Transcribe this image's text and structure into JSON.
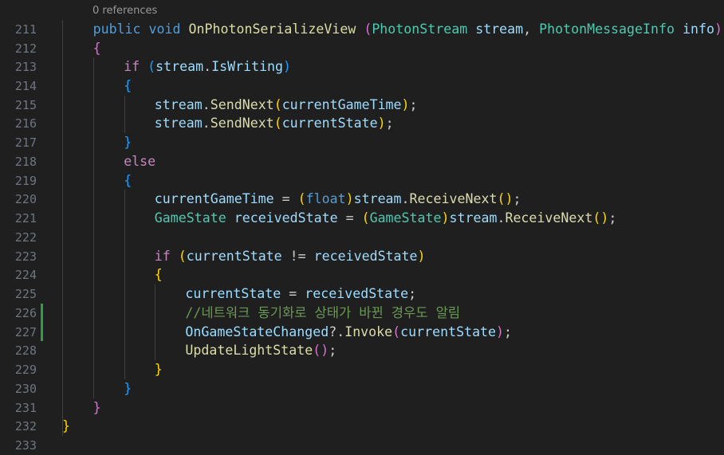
{
  "codelens": "0 references",
  "lines": [
    {
      "num": "211",
      "indent": 1,
      "tokens": [
        [
          "public",
          "kw"
        ],
        [
          " ",
          ""
        ],
        [
          "void",
          "kw"
        ],
        [
          " ",
          ""
        ],
        [
          "OnPhotonSerializeView",
          "fn"
        ],
        [
          " ",
          ""
        ],
        [
          "(",
          "b2"
        ],
        [
          "PhotonStream",
          "type"
        ],
        [
          " ",
          ""
        ],
        [
          "stream",
          "var"
        ],
        [
          ", ",
          ""
        ],
        [
          "PhotonMessageInfo",
          "type"
        ],
        [
          " ",
          ""
        ],
        [
          "info",
          "var"
        ],
        [
          ")",
          "b2"
        ]
      ]
    },
    {
      "num": "212",
      "indent": 1,
      "tokens": [
        [
          "{",
          "b2"
        ]
      ]
    },
    {
      "num": "213",
      "indent": 2,
      "tokens": [
        [
          "if",
          "ctrl"
        ],
        [
          " ",
          ""
        ],
        [
          "(",
          "b3"
        ],
        [
          "stream",
          "var"
        ],
        [
          ".",
          ""
        ],
        [
          "IsWriting",
          "var"
        ],
        [
          ")",
          "b3"
        ]
      ]
    },
    {
      "num": "214",
      "indent": 2,
      "tokens": [
        [
          "{",
          "b3"
        ]
      ]
    },
    {
      "num": "215",
      "indent": 3,
      "tokens": [
        [
          "stream",
          "var"
        ],
        [
          ".",
          ""
        ],
        [
          "SendNext",
          "fn"
        ],
        [
          "(",
          "b1"
        ],
        [
          "currentGameTime",
          "var"
        ],
        [
          ")",
          "b1"
        ],
        [
          ";",
          ""
        ]
      ]
    },
    {
      "num": "216",
      "indent": 3,
      "tokens": [
        [
          "stream",
          "var"
        ],
        [
          ".",
          ""
        ],
        [
          "SendNext",
          "fn"
        ],
        [
          "(",
          "b1"
        ],
        [
          "currentState",
          "var"
        ],
        [
          ")",
          "b1"
        ],
        [
          ";",
          ""
        ]
      ]
    },
    {
      "num": "217",
      "indent": 2,
      "tokens": [
        [
          "}",
          "b3"
        ]
      ]
    },
    {
      "num": "218",
      "indent": 2,
      "tokens": [
        [
          "else",
          "ctrl"
        ]
      ]
    },
    {
      "num": "219",
      "indent": 2,
      "tokens": [
        [
          "{",
          "b3"
        ]
      ]
    },
    {
      "num": "220",
      "indent": 3,
      "tokens": [
        [
          "currentGameTime",
          "var"
        ],
        [
          " = ",
          ""
        ],
        [
          "(",
          "b1"
        ],
        [
          "float",
          "kw"
        ],
        [
          ")",
          "b1"
        ],
        [
          "stream",
          "var"
        ],
        [
          ".",
          ""
        ],
        [
          "ReceiveNext",
          "fn"
        ],
        [
          "()",
          "b1"
        ],
        [
          ";",
          ""
        ]
      ]
    },
    {
      "num": "221",
      "indent": 3,
      "tokens": [
        [
          "GameState",
          "type"
        ],
        [
          " ",
          ""
        ],
        [
          "receivedState",
          "var"
        ],
        [
          " = ",
          ""
        ],
        [
          "(",
          "b1"
        ],
        [
          "GameState",
          "type"
        ],
        [
          ")",
          "b1"
        ],
        [
          "stream",
          "var"
        ],
        [
          ".",
          ""
        ],
        [
          "ReceiveNext",
          "fn"
        ],
        [
          "()",
          "b1"
        ],
        [
          ";",
          ""
        ]
      ]
    },
    {
      "num": "222",
      "indent": 0,
      "tokens": []
    },
    {
      "num": "223",
      "indent": 3,
      "tokens": [
        [
          "if",
          "ctrl"
        ],
        [
          " ",
          ""
        ],
        [
          "(",
          "b1"
        ],
        [
          "currentState",
          "var"
        ],
        [
          " != ",
          ""
        ],
        [
          "receivedState",
          "var"
        ],
        [
          ")",
          "b1"
        ]
      ]
    },
    {
      "num": "224",
      "indent": 3,
      "tokens": [
        [
          "{",
          "b1"
        ]
      ]
    },
    {
      "num": "225",
      "indent": 4,
      "tokens": [
        [
          "currentState",
          "var"
        ],
        [
          " = ",
          ""
        ],
        [
          "receivedState",
          "var"
        ],
        [
          ";",
          ""
        ]
      ]
    },
    {
      "num": "226",
      "indent": 4,
      "tokens": [
        [
          "//네트워크 동기화로 상태가 바뀐 경우도 알림",
          "cm"
        ]
      ]
    },
    {
      "num": "227",
      "indent": 4,
      "tokens": [
        [
          "OnGameStateChanged",
          "var"
        ],
        [
          "?.",
          ""
        ],
        [
          "Invoke",
          "fn"
        ],
        [
          "(",
          "b2"
        ],
        [
          "currentState",
          "var"
        ],
        [
          ")",
          "b2"
        ],
        [
          ";",
          ""
        ]
      ]
    },
    {
      "num": "228",
      "indent": 4,
      "tokens": [
        [
          "UpdateLightState",
          "fn"
        ],
        [
          "()",
          "b2"
        ],
        [
          ";",
          ""
        ]
      ]
    },
    {
      "num": "229",
      "indent": 3,
      "tokens": [
        [
          "}",
          "b1"
        ]
      ]
    },
    {
      "num": "230",
      "indent": 2,
      "tokens": [
        [
          "}",
          "b3"
        ]
      ]
    },
    {
      "num": "231",
      "indent": 1,
      "tokens": [
        [
          "}",
          "b2"
        ]
      ]
    },
    {
      "num": "232",
      "indent": 0,
      "tokens": [
        [
          "}",
          "b1"
        ]
      ]
    },
    {
      "num": "233",
      "indent": 0,
      "tokens": []
    }
  ]
}
